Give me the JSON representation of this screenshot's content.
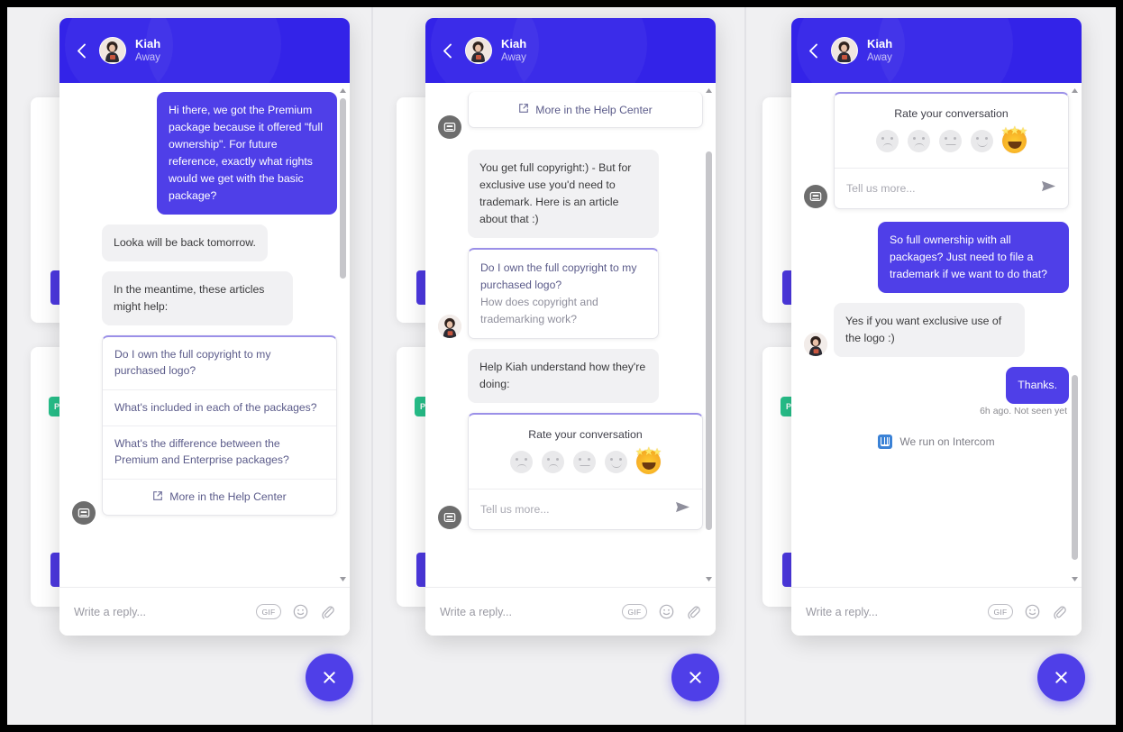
{
  "header": {
    "name": "Kiah",
    "status": "Away",
    "back_icon": "chevron-left-icon",
    "avatar_icon": "agent-avatar"
  },
  "composer": {
    "placeholder": "Write a reply...",
    "gif_label": "GIF",
    "emoji_icon": "smiley-icon",
    "attach_icon": "paperclip-icon"
  },
  "launcher": {
    "close_icon": "close-icon"
  },
  "colors": {
    "header_purple": "#3323e8",
    "bubble_purple": "#4f3fe8",
    "bubble_gray": "#f1f1f3",
    "accent_top_border": "#9b90e8",
    "badge_green": "#27c08a",
    "intercom_blue": "#3b82d6"
  },
  "rating": {
    "title": "Rate your conversation",
    "input_placeholder": "Tell us more...",
    "send_icon": "send-icon",
    "faces": [
      {
        "name": "angry-face",
        "selected": false
      },
      {
        "name": "sad-face",
        "selected": false
      },
      {
        "name": "neutral-face",
        "selected": false
      },
      {
        "name": "happy-face",
        "selected": false
      },
      {
        "name": "star-struck-face",
        "selected": true
      }
    ]
  },
  "help_center": {
    "label": "More in the Help Center",
    "icon": "external-link-icon"
  },
  "intercom": {
    "label": "We run on Intercom",
    "icon": "intercom-logo-icon"
  },
  "panel1": {
    "messages": [
      {
        "side": "out",
        "text": "Hi there, we got the Premium package because it offered \"full ownership\". For future reference, exactly what rights would we get with the basic package?"
      },
      {
        "side": "in",
        "text": "Looka will be back tomorrow."
      },
      {
        "side": "in",
        "text": "In the meantime, these articles might help:"
      }
    ],
    "articles": [
      "Do I own the full copyright to my purchased logo?",
      "What's included in each of the packages?",
      "What's the difference between the Premium and Enterprise packages?"
    ]
  },
  "panel2": {
    "top_help_center": "More in the Help Center",
    "messages": [
      {
        "side": "in",
        "text": "You get full copyright:) - But for exclusive use you'd need to trademark. Here is an article about that :)"
      },
      {
        "side": "in",
        "text": "Help Kiah understand how they're doing:"
      }
    ],
    "quote_card": {
      "line1": "Do I own the full copyright to my purchased logo?",
      "line2": "How does copyright and trademarking work?"
    }
  },
  "panel3": {
    "messages": [
      {
        "side": "out",
        "text": "So full ownership with all packages? Just need to file a trademark if we want to do that?"
      },
      {
        "side": "in",
        "text": "Yes if you want exclusive use of the logo :)"
      },
      {
        "side": "out",
        "text": "Thanks."
      }
    ],
    "meta": "6h ago. Not seen yet"
  },
  "background": {
    "badge_label": "PO"
  }
}
